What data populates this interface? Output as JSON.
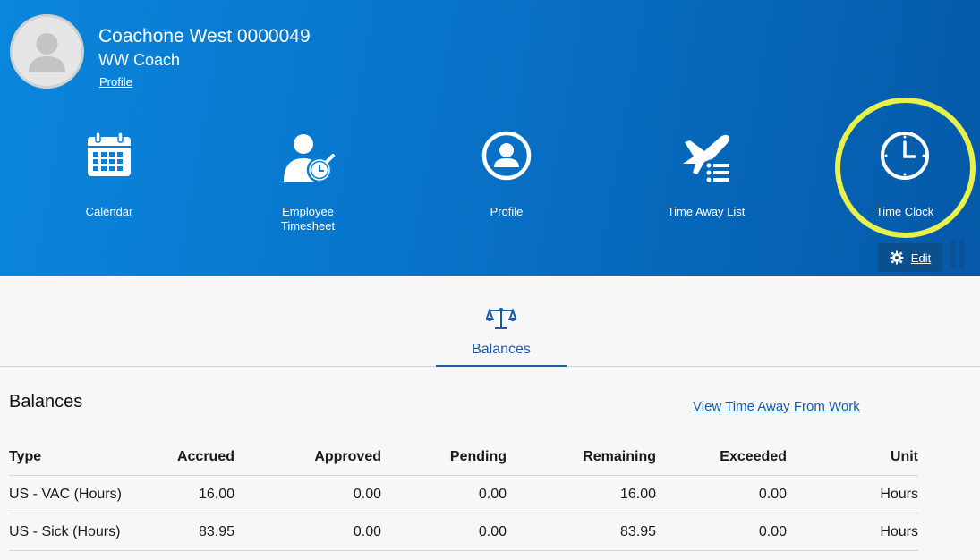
{
  "user": {
    "name": "Coachone West 0000049",
    "role": "WW Coach",
    "profile_link": "Profile"
  },
  "tiles": [
    {
      "label": "Calendar",
      "icon": "calendar-icon"
    },
    {
      "label": "Employee\nTimesheet",
      "icon": "employee-timesheet-icon"
    },
    {
      "label": "Profile",
      "icon": "profile-circle-icon"
    },
    {
      "label": "Time Away List",
      "icon": "airplane-list-icon"
    },
    {
      "label": "Time Clock",
      "icon": "clock-icon"
    }
  ],
  "edit_label": "Edit",
  "tab": {
    "label": "Balances",
    "icon": "scales-icon"
  },
  "balances": {
    "title": "Balances",
    "view_link": "View Time Away From Work",
    "columns": [
      "Type",
      "Accrued",
      "Approved",
      "Pending",
      "Remaining",
      "Exceeded",
      "Unit"
    ],
    "rows": [
      [
        "US - VAC (Hours)",
        "16.00",
        "0.00",
        "0.00",
        "16.00",
        "0.00",
        "Hours"
      ],
      [
        "US - Sick (Hours)",
        "83.95",
        "0.00",
        "0.00",
        "83.95",
        "0.00",
        "Hours"
      ]
    ]
  },
  "colors": {
    "header_start": "#0a86dc",
    "header_end": "#0559a8",
    "highlight": "#e8f04a",
    "link": "#1b5ba8"
  }
}
